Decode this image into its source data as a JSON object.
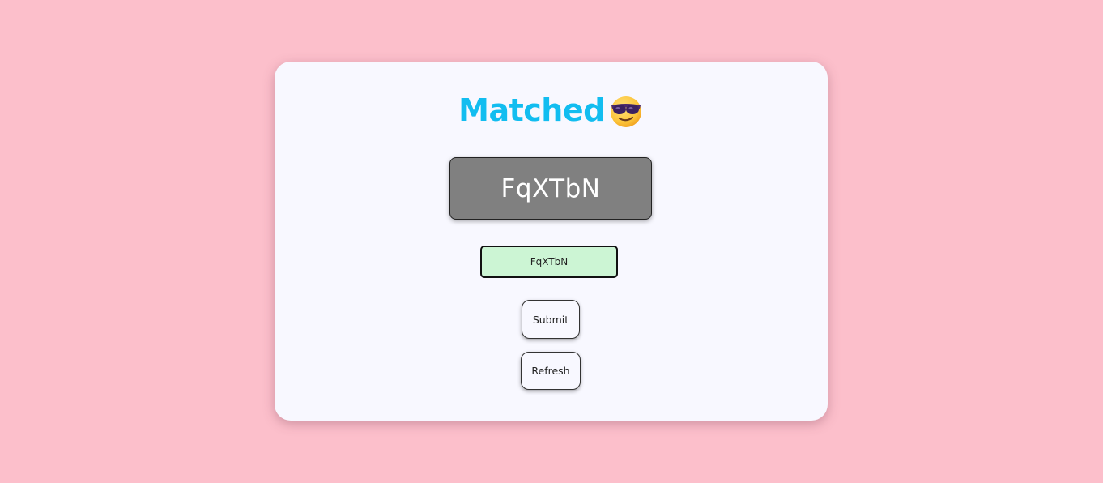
{
  "status": {
    "title": "Matched",
    "emoji": "smiling-face-with-sunglasses-icon"
  },
  "captcha": {
    "code": "FqXTbN"
  },
  "input": {
    "value": "FqXTbN",
    "match_color": "#ccf5d4"
  },
  "buttons": {
    "submit_label": "Submit",
    "refresh_label": "Refresh"
  },
  "colors": {
    "page_background": "#fcbfcb",
    "card_background": "#f8f8ff",
    "title_color": "#12bdf0",
    "captcha_background": "#808080",
    "captcha_text": "#ffffff"
  }
}
